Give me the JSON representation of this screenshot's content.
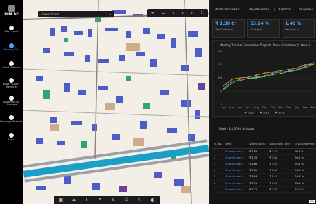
{
  "nav": {
    "brand": "DMA-AP",
    "items": [
      {
        "label": "Site Layout"
      },
      {
        "label": "Property Tax",
        "active": true
      },
      {
        "label": "Road Network"
      },
      {
        "label": "Water Supply Network"
      },
      {
        "label": "Underground Drainage"
      },
      {
        "label": "Drainage Network"
      },
      {
        "label": "More"
      }
    ]
  },
  "search": {
    "placeholder": "Search Here"
  },
  "breadcrumb": [
    "Andhrapradesh",
    "Rayalaseema",
    "Krishna",
    "Vuyyuru"
  ],
  "kpis": [
    {
      "value": "₹ 1.38 Cr",
      "label": "Tax Collection"
    },
    {
      "value": "53.24 %",
      "label": "Of Target"
    },
    {
      "value": "1.48 %",
      "label": "Ver From LY"
    }
  ],
  "chart": {
    "title": "Monthly Trend of Cumulative Property Taxes Collections (₹ Lakhs)",
    "legend": [
      "2020",
      "2019",
      "2018"
    ],
    "colors": [
      "#f08a24",
      "#4aa3ff",
      "#7ac943"
    ]
  },
  "chart_data": {
    "type": "line",
    "categories": [
      "Apr",
      "May",
      "Jun",
      "Jul",
      "Aug",
      "Sep",
      "Oct",
      "Nov",
      "Dec",
      "Jan",
      "Feb",
      "Mar"
    ],
    "ylim": [
      0,
      200
    ],
    "yticks": [
      0,
      50,
      100,
      150,
      200
    ],
    "series": [
      {
        "name": "2020",
        "values": [
          70,
          95,
          100,
          102,
          110,
          118,
          122,
          128,
          132,
          138,
          150,
          152
        ]
      },
      {
        "name": "2019",
        "values": [
          60,
          88,
          90,
          98,
          103,
          108,
          118,
          122,
          126,
          132,
          145,
          158
        ]
      },
      {
        "name": "2018",
        "values": [
          55,
          80,
          95,
          97,
          100,
          105,
          112,
          116,
          124,
          130,
          140,
          150
        ]
      }
    ]
  },
  "table": {
    "title": "Ward - 1st 2020 for today",
    "headers": [
      "Sl. No.",
      "Ward",
      "Target (Lakh)",
      "Collection (Lakh)",
      "% Achievement"
    ],
    "rows": [
      [
        "1",
        "Shramik ward 1",
        "₹ 3.55",
        "₹ 3.53",
        "99.5 %"
      ],
      [
        "2",
        "Shramik ward 2",
        "₹ 3.75",
        "₹ 3.62",
        "96.5 %"
      ],
      [
        "3",
        "Shramik ward 3",
        "₹ 3.66",
        "₹ 3.49",
        "95.3 %"
      ],
      [
        "4",
        "Shramik ward 4",
        "₹ 3.90",
        "₹ 3.64",
        "93.3 %"
      ],
      [
        "5",
        "Shramik ward 5",
        "₹ 3.84",
        "₹ 3.49",
        "90.8 %"
      ],
      [
        "6",
        "Shramik ward 6",
        "₹ 3.91",
        "₹ 3.25",
        "83.1 %"
      ],
      [
        "7",
        "Shramik ward 7",
        "₹ 3.72",
        "₹ 2.93",
        "78.7 %"
      ]
    ]
  }
}
